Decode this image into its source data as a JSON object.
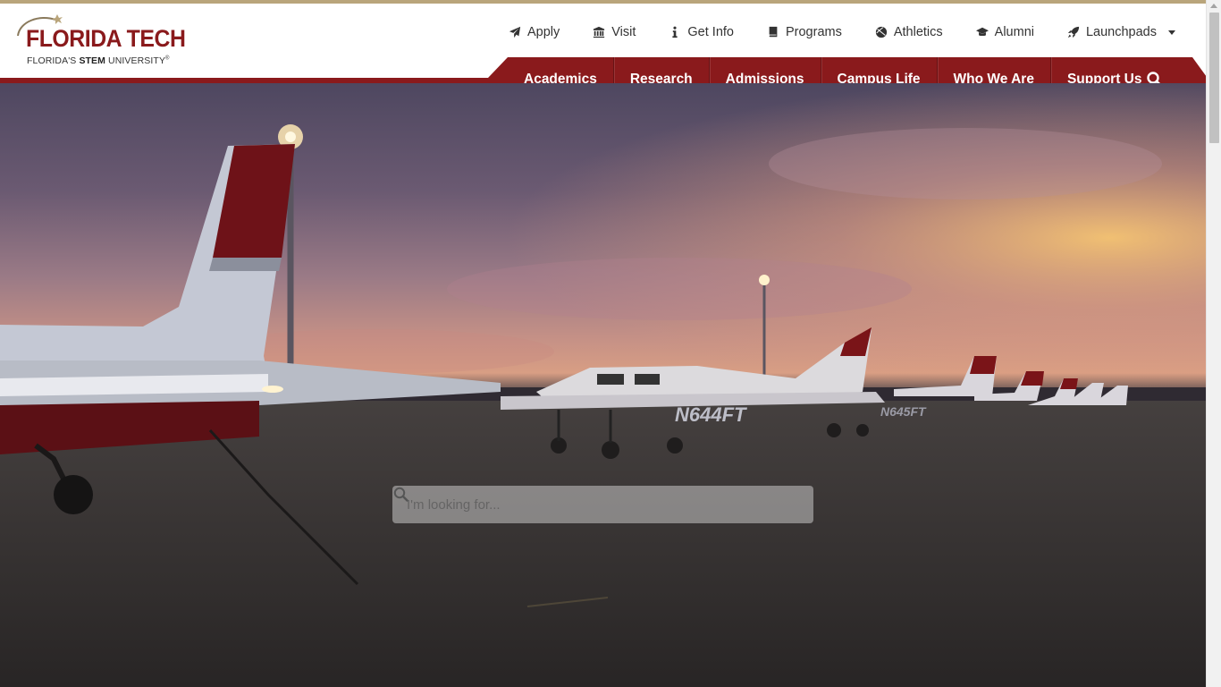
{
  "brand": {
    "title": "FLORIDA TECH",
    "subtitle_prefix": "FLORIDA'S ",
    "subtitle_bold": "STEM",
    "subtitle_suffix": " UNIVERSITY",
    "trademark": "®",
    "primary_color": "#8a1a1c",
    "accent_color": "#b9a57b"
  },
  "utility_nav": [
    {
      "label": "Apply",
      "icon": "paper-plane-icon"
    },
    {
      "label": "Visit",
      "icon": "building-columns-icon"
    },
    {
      "label": "Get Info",
      "icon": "info-icon"
    },
    {
      "label": "Programs",
      "icon": "book-icon"
    },
    {
      "label": "Athletics",
      "icon": "ball-icon"
    },
    {
      "label": "Alumni",
      "icon": "graduation-cap-icon"
    },
    {
      "label": "Launchpads",
      "icon": "rocket-icon"
    }
  ],
  "main_nav": [
    {
      "label": "Academics"
    },
    {
      "label": "Research"
    },
    {
      "label": "Admissions"
    },
    {
      "label": "Campus Life"
    },
    {
      "label": "Who We Are"
    },
    {
      "label": "Support Us"
    }
  ],
  "hero": {
    "search_placeholder": "I'm looking for...",
    "tail_number": "N644FT",
    "tail_number_2": "N645FT"
  }
}
